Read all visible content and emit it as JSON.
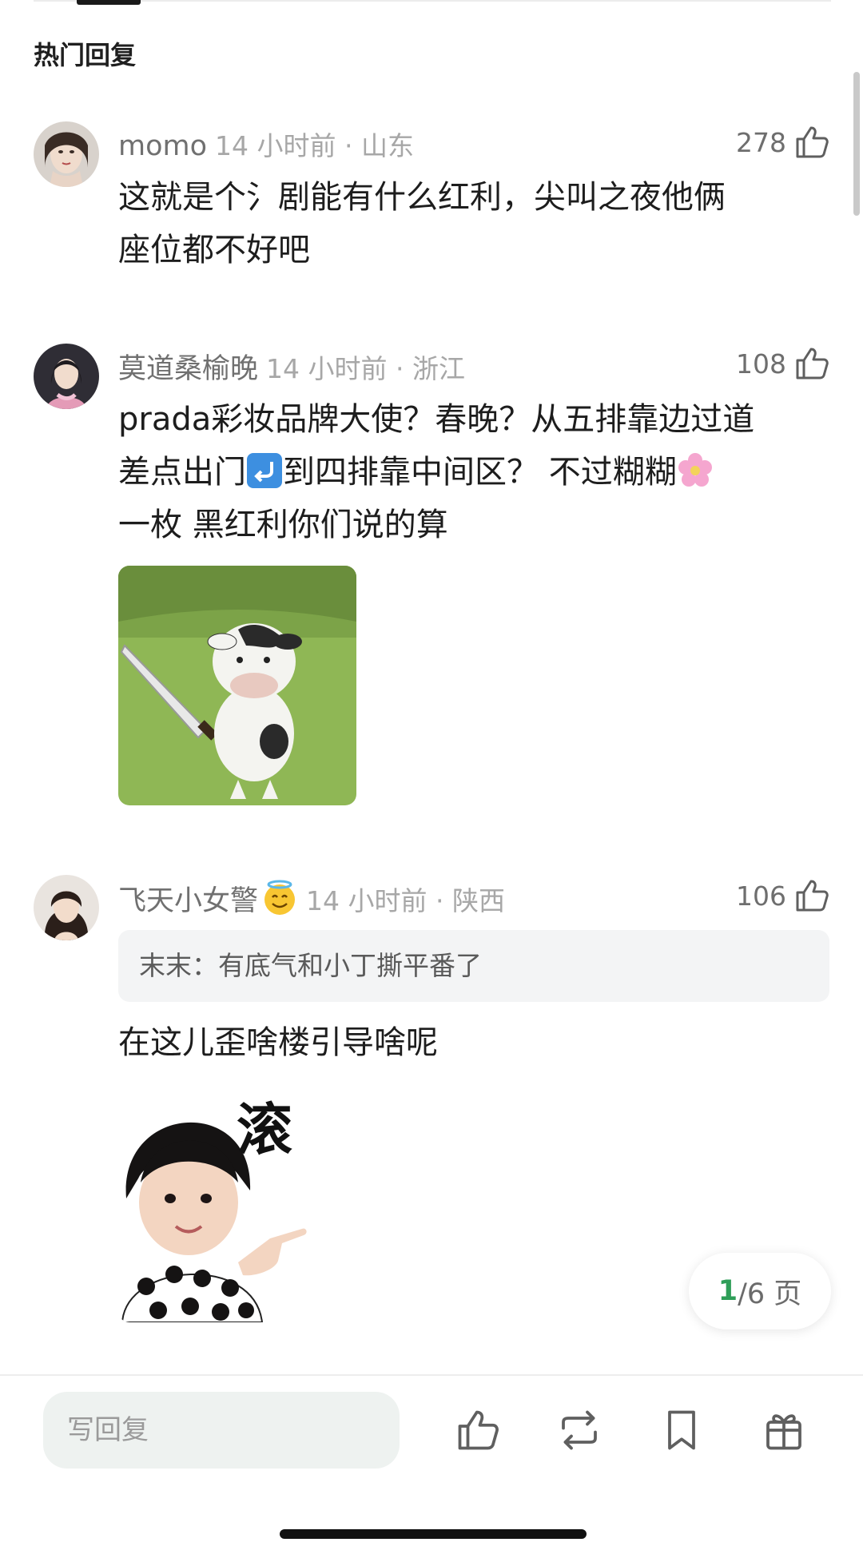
{
  "section": {
    "title": "热门回复"
  },
  "comments": [
    {
      "username": "momo",
      "time_location": "14 小时前 · 山东",
      "likes": "278",
      "text_line1": "这就是个氵剧能有什么红利，尖叫之夜他俩",
      "text_line2": "座位都不好吧"
    },
    {
      "username": "莫道桑榆晚",
      "time_location": "14 小时前 · 浙江",
      "likes": "108",
      "text_line1": "prada彩妆品牌大使？春晚？从五排靠边过道",
      "text_line2_a": "差点出门",
      "text_line2_b": "到四排靠中间区？ 不过糊糊",
      "text_line3": "一枚 黑红利你们说的算"
    },
    {
      "username": "飞天小女警",
      "time_location": "14 小时前 · 陕西",
      "likes": "106",
      "quote": "末末：有底气和小丁撕平番了",
      "text_line1": "在这儿歪啥楼引导啥呢",
      "sticker_text": "滚"
    }
  ],
  "pagination": {
    "current": "1",
    "rest": "/6 页"
  },
  "bottom_bar": {
    "reply_placeholder": "写回复"
  },
  "colors": {
    "accent": "#2f9e58",
    "muted": "#a7a7a7"
  }
}
